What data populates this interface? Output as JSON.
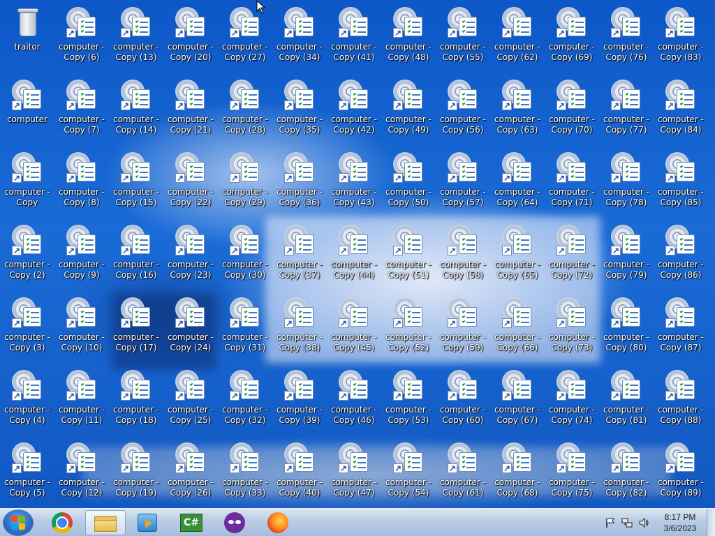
{
  "desktop": {
    "recycle_bin": {
      "label": "traitor",
      "icon": "recycle-bin-icon"
    },
    "shortcuts": [
      {
        "line1": "computer",
        "line2": ""
      },
      {
        "line1": "computer -",
        "line2": "Copy"
      },
      {
        "line1": "computer -",
        "line2": "Copy (2)"
      },
      {
        "line1": "computer -",
        "line2": "Copy (3)"
      },
      {
        "line1": "computer -",
        "line2": "Copy (4)"
      },
      {
        "line1": "computer -",
        "line2": "Copy (5)"
      },
      {
        "line1": "computer -",
        "line2": "Copy (6)"
      },
      {
        "line1": "computer -",
        "line2": "Copy (7)"
      },
      {
        "line1": "computer -",
        "line2": "Copy (8)"
      },
      {
        "line1": "computer -",
        "line2": "Copy (9)"
      },
      {
        "line1": "computer -",
        "line2": "Copy (10)"
      },
      {
        "line1": "computer -",
        "line2": "Copy (11)"
      },
      {
        "line1": "computer -",
        "line2": "Copy (12)"
      },
      {
        "line1": "computer -",
        "line2": "Copy (13)"
      },
      {
        "line1": "computer -",
        "line2": "Copy (14)"
      },
      {
        "line1": "computer -",
        "line2": "Copy (15)"
      },
      {
        "line1": "computer -",
        "line2": "Copy (16)"
      },
      {
        "line1": "computer -",
        "line2": "Copy (17)"
      },
      {
        "line1": "computer -",
        "line2": "Copy (18)"
      },
      {
        "line1": "computer -",
        "line2": "Copy (19)"
      },
      {
        "line1": "computer -",
        "line2": "Copy (20)"
      },
      {
        "line1": "computer -",
        "line2": "Copy (21)"
      },
      {
        "line1": "computer -",
        "line2": "Copy (22)"
      },
      {
        "line1": "computer -",
        "line2": "Copy (23)"
      },
      {
        "line1": "computer -",
        "line2": "Copy (24)"
      },
      {
        "line1": "computer -",
        "line2": "Copy (25)"
      },
      {
        "line1": "computer -",
        "line2": "Copy (26)"
      },
      {
        "line1": "computer -",
        "line2": "Copy (27)"
      },
      {
        "line1": "computer -",
        "line2": "Copy (28)"
      },
      {
        "line1": "computer -",
        "line2": "Copy (29)"
      },
      {
        "line1": "computer -",
        "line2": "Copy (30)"
      },
      {
        "line1": "computer -",
        "line2": "Copy (31)"
      },
      {
        "line1": "computer -",
        "line2": "Copy (32)"
      },
      {
        "line1": "computer -",
        "line2": "Copy (33)"
      },
      {
        "line1": "computer -",
        "line2": "Copy (34)"
      },
      {
        "line1": "computer -",
        "line2": "Copy (35)"
      },
      {
        "line1": "computer -",
        "line2": "Copy (36)"
      },
      {
        "line1": "computer -",
        "line2": "Copy (37)"
      },
      {
        "line1": "computer -",
        "line2": "Copy (38)"
      },
      {
        "line1": "computer -",
        "line2": "Copy (39)"
      },
      {
        "line1": "computer -",
        "line2": "Copy (40)"
      },
      {
        "line1": "computer -",
        "line2": "Copy (41)"
      },
      {
        "line1": "computer -",
        "line2": "Copy (42)"
      },
      {
        "line1": "computer -",
        "line2": "Copy (43)"
      },
      {
        "line1": "computer -",
        "line2": "Copy (44)"
      },
      {
        "line1": "computer -",
        "line2": "Copy (45)"
      },
      {
        "line1": "computer -",
        "line2": "Copy (46)"
      },
      {
        "line1": "computer -",
        "line2": "Copy (47)"
      },
      {
        "line1": "computer -",
        "line2": "Copy (48)"
      },
      {
        "line1": "computer -",
        "line2": "Copy (49)"
      },
      {
        "line1": "computer -",
        "line2": "Copy (50)"
      },
      {
        "line1": "computer -",
        "line2": "Copy (51)"
      },
      {
        "line1": "computer -",
        "line2": "Copy (52)"
      },
      {
        "line1": "computer -",
        "line2": "Copy (53)"
      },
      {
        "line1": "computer -",
        "line2": "Copy (54)"
      },
      {
        "line1": "computer -",
        "line2": "Copy (55)"
      },
      {
        "line1": "computer -",
        "line2": "Copy (56)"
      },
      {
        "line1": "computer -",
        "line2": "Copy (57)"
      },
      {
        "line1": "computer -",
        "line2": "Copy (58)"
      },
      {
        "line1": "computer -",
        "line2": "Copy (59)"
      },
      {
        "line1": "computer -",
        "line2": "Copy (60)"
      },
      {
        "line1": "computer -",
        "line2": "Copy (61)"
      },
      {
        "line1": "computer -",
        "line2": "Copy (62)"
      },
      {
        "line1": "computer -",
        "line2": "Copy (63)"
      },
      {
        "line1": "computer -",
        "line2": "Copy (64)"
      },
      {
        "line1": "computer -",
        "line2": "Copy (65)"
      },
      {
        "line1": "computer -",
        "line2": "Copy (66)"
      },
      {
        "line1": "computer -",
        "line2": "Copy (67)"
      },
      {
        "line1": "computer -",
        "line2": "Copy (68)"
      },
      {
        "line1": "computer -",
        "line2": "Copy (69)"
      },
      {
        "line1": "computer -",
        "line2": "Copy (70)"
      },
      {
        "line1": "computer -",
        "line2": "Copy (71)"
      },
      {
        "line1": "computer -",
        "line2": "Copy (72)"
      },
      {
        "line1": "computer -",
        "line2": "Copy (73)"
      },
      {
        "line1": "computer -",
        "line2": "Copy (74)"
      },
      {
        "line1": "computer -",
        "line2": "Copy (75)"
      },
      {
        "line1": "computer -",
        "line2": "Copy (76)"
      },
      {
        "line1": "computer -",
        "line2": "Copy (77)"
      },
      {
        "line1": "computer -",
        "line2": "Copy (78)"
      },
      {
        "line1": "computer -",
        "line2": "Copy (79)"
      },
      {
        "line1": "computer -",
        "line2": "Copy (80)"
      },
      {
        "line1": "computer -",
        "line2": "Copy (81)"
      },
      {
        "line1": "computer -",
        "line2": "Copy (82)"
      },
      {
        "line1": "computer -",
        "line2": "Copy (83)"
      },
      {
        "line1": "computer -",
        "line2": "Copy (84)"
      },
      {
        "line1": "computer -",
        "line2": "Copy (85)"
      },
      {
        "line1": "computer -",
        "line2": "Copy (86)"
      },
      {
        "line1": "computer -",
        "line2": "Copy (87)"
      },
      {
        "line1": "computer -",
        "line2": "Copy (88)"
      },
      {
        "line1": "computer -",
        "line2": "Copy (89)"
      }
    ],
    "shortcut_icon": "control-panel-shortcut-icon"
  },
  "taskbar": {
    "start_icon": "windows-start-orb-icon",
    "pinned": [
      {
        "name": "chrome",
        "icon": "chrome-icon"
      },
      {
        "name": "file-explorer",
        "icon": "folder-icon",
        "active": true
      },
      {
        "name": "media-player",
        "icon": "media-player-icon"
      },
      {
        "name": "csharp-app",
        "icon": "csharp-icon",
        "text": "C#"
      },
      {
        "name": "mask-app",
        "icon": "mask-icon"
      },
      {
        "name": "firefox",
        "icon": "firefox-icon"
      }
    ],
    "tray_icons": [
      "action-center-flag-icon",
      "network-icon",
      "volume-icon"
    ],
    "clock": {
      "time": "8:17 PM",
      "date": "3/6/2023"
    }
  },
  "colors": {
    "desktop_blue": "#1560c4",
    "taskbar": "#b9cce4"
  }
}
